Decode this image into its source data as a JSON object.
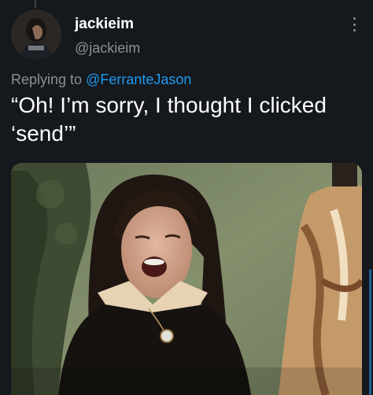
{
  "tweet": {
    "author": {
      "display_name": "jackieim",
      "handle": "@jackieim",
      "avatar": "avatar-photo"
    },
    "reply": {
      "prefix": "Replying to",
      "mention": "@FerranteJason"
    },
    "text": "“Oh! I’m sorry, I thought I clicked ‘send’”",
    "media": {
      "kind": "photo",
      "subject": "woman winking with mouth open"
    }
  },
  "icons": {
    "more": "more-vertical-icon"
  },
  "colors": {
    "background": "#15181c",
    "primary_text": "#ffffff",
    "secondary_text": "#8b9197",
    "link": "#1d9bf0"
  }
}
